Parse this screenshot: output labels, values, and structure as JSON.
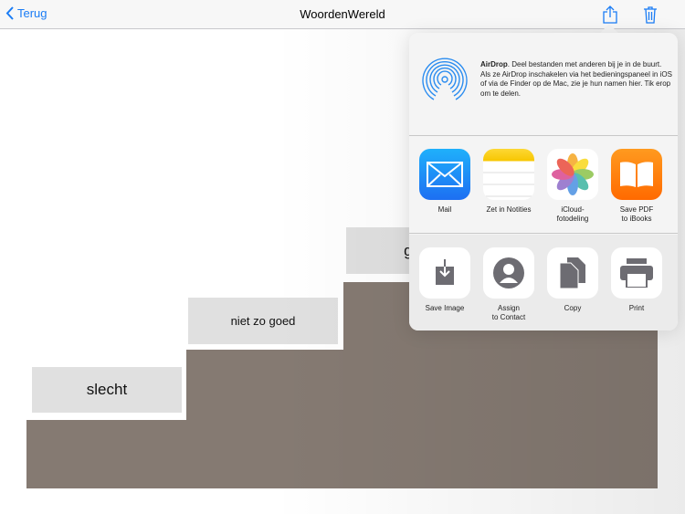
{
  "nav": {
    "back_label": "Terug",
    "title": "WoordenWereld"
  },
  "cards": [
    "slecht",
    "niet zo goed",
    "goed"
  ],
  "share": {
    "airdrop_title": "AirDrop",
    "airdrop_text": ". Deel bestanden met anderen bij je in de buurt. Als ze AirDrop inschakelen via het bedieningspaneel in iOS of via de Finder op de Mac, zie je hun namen hier. Tik erop om te delen.",
    "apps": [
      {
        "line1": "Mail",
        "line2": ""
      },
      {
        "line1": "Zet in Notities",
        "line2": ""
      },
      {
        "line1": "iCloud-",
        "line2": "fotodeling"
      },
      {
        "line1": "Save PDF",
        "line2": "to iBooks"
      }
    ],
    "actions": [
      {
        "line1": "Save Image",
        "line2": ""
      },
      {
        "line1": "Assign",
        "line2": "to Contact"
      },
      {
        "line1": "Copy",
        "line2": ""
      },
      {
        "line1": "Print",
        "line2": ""
      }
    ]
  }
}
